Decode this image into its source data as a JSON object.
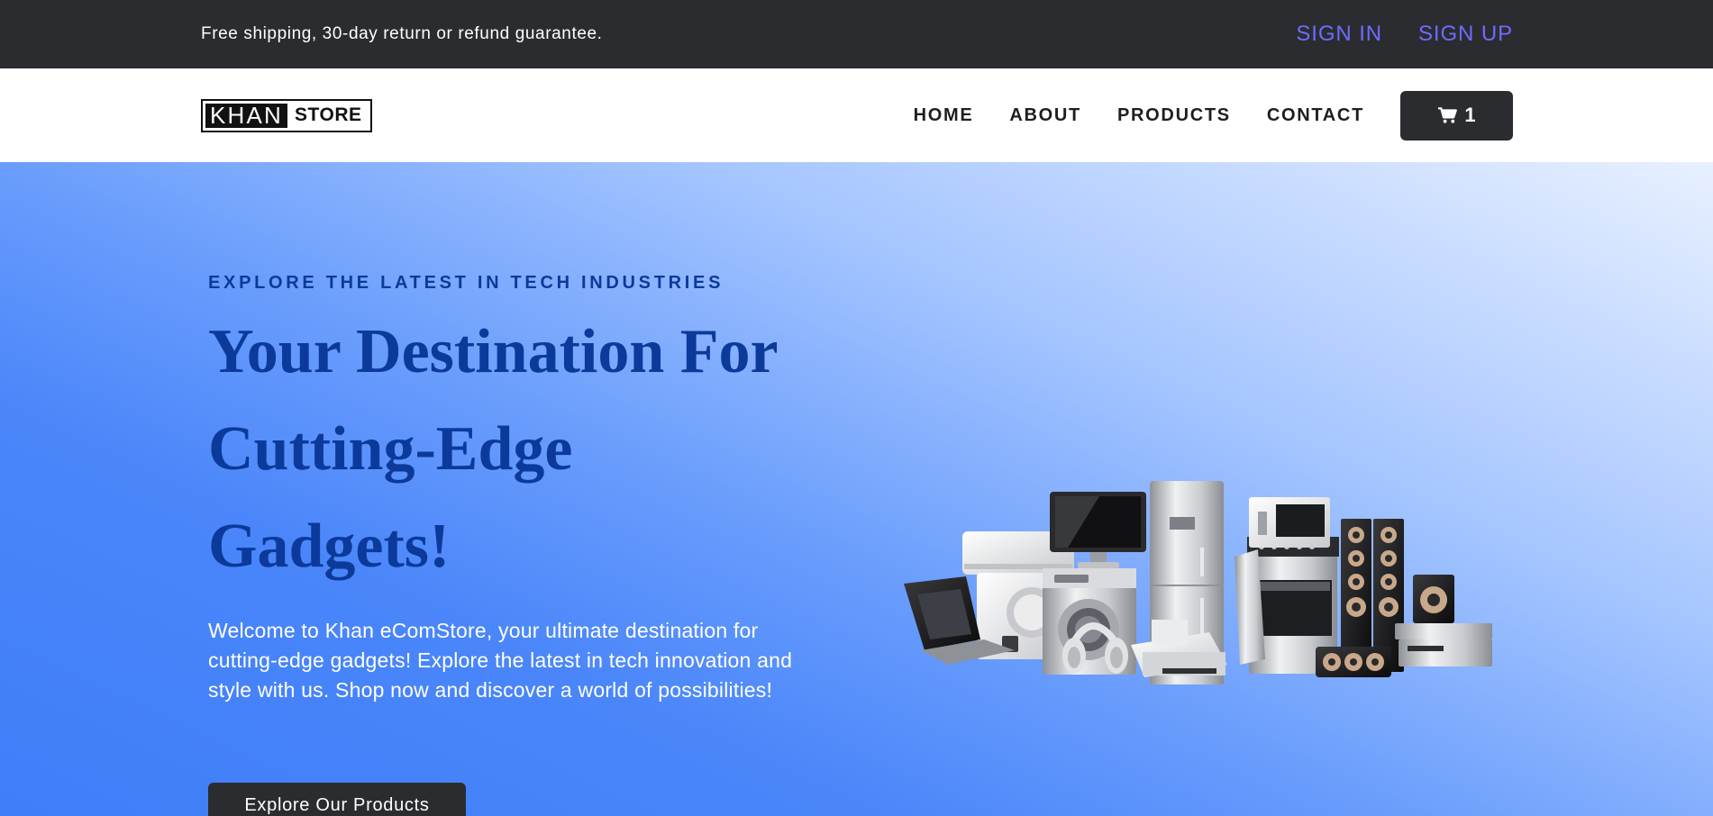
{
  "topbar": {
    "announcement": "Free shipping, 30-day return or refund guarantee.",
    "sign_in": "SIGN IN",
    "sign_up": "SIGN UP"
  },
  "brand": {
    "logo_dark": "KHAN",
    "logo_light": "STORE"
  },
  "nav": {
    "items": [
      {
        "label": "HOME"
      },
      {
        "label": "ABOUT"
      },
      {
        "label": "PRODUCTS"
      },
      {
        "label": "CONTACT"
      }
    ],
    "cart_count": "1",
    "cart_icon": "shopping-cart-icon"
  },
  "hero": {
    "eyebrow": "EXPLORE THE LATEST IN TECH INDUSTRIES",
    "title": "Your Destination For Cutting-Edge Gadgets!",
    "description": "Welcome to Khan eComStore, your ultimate destination for cutting-edge gadgets! Explore the latest in tech innovation and style with us. Shop now and discover a world of possibilities!",
    "cta": "Explore Our Products"
  },
  "colors": {
    "dark": "#2b2c30",
    "link": "#6f6bff",
    "headline": "#0b3a9a",
    "hero_start": "#3f7ef8",
    "hero_end": "#e8f0ff"
  }
}
